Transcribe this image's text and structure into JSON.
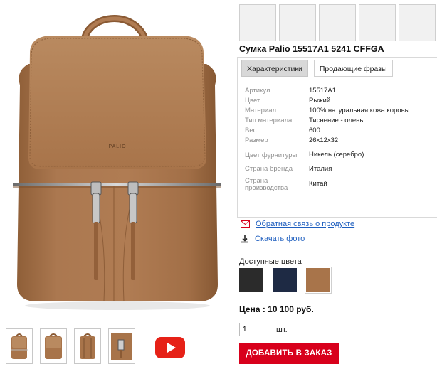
{
  "product": {
    "title": "Сумка Palio 15517A1 5241 CFFGA",
    "logo_text": "PALIO",
    "bag_color": "#a8744a"
  },
  "tabs": [
    {
      "label": "Характеристики",
      "active": true
    },
    {
      "label": "Продающие фразы",
      "active": false
    }
  ],
  "specs": [
    {
      "label": "Артикул",
      "value": "15517A1"
    },
    {
      "label": "Цвет",
      "value": "Рыжий"
    },
    {
      "label": "Материал",
      "value": "100% натуральная кожа коровы"
    },
    {
      "label": "Тип материала",
      "value": "Тиснение - олень"
    },
    {
      "label": "Вес",
      "value": "600"
    },
    {
      "label": "Размер",
      "value": "26x12x32"
    },
    {
      "label": "Цвет фурнитуры",
      "value": "Никель (серебро)"
    },
    {
      "label": "Страна бренда",
      "value": "Италия"
    },
    {
      "label": "Страна производства",
      "value": "Китай"
    }
  ],
  "links": {
    "feedback": "Обратная связь о продукте",
    "download": "Скачать фото"
  },
  "colors": {
    "label": "Доступные цвета",
    "swatches": [
      "#2b2b2b",
      "#1e2a44",
      "#a8744a"
    ]
  },
  "price": "Цена : 10 100 руб.",
  "quantity": {
    "value": "1",
    "unit": "шт."
  },
  "order_button": "ДОБАВИТЬ В ЗАКАЗ",
  "accent": {
    "red": "#d8001c",
    "link": "#1f5fbf",
    "youtube": "#e62117"
  }
}
